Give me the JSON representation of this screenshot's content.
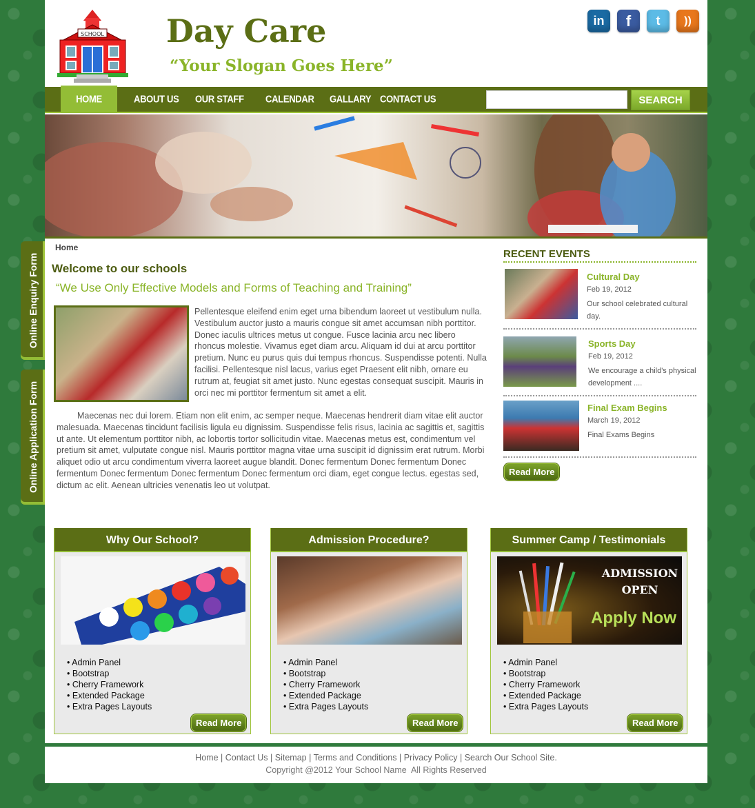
{
  "header": {
    "title": "Day Care",
    "slogan": "“Your Slogan Goes Here”",
    "logo_sign": "SCHOOL",
    "social": [
      {
        "icon": "linkedin-icon",
        "glyph": "in"
      },
      {
        "icon": "facebook-icon",
        "glyph": "f"
      },
      {
        "icon": "twitter-icon",
        "glyph": "t"
      },
      {
        "icon": "rss-icon",
        "glyph": "))"
      }
    ]
  },
  "nav": {
    "items": [
      "Home",
      "About Us",
      "Our Staff",
      "Calendar",
      "Gallary",
      "Contact Us"
    ],
    "search_placeholder": "",
    "search_label": "Search"
  },
  "side_tabs": [
    "Online Enquiry Form",
    "Online Application Form"
  ],
  "breadcrumb": "Home",
  "main": {
    "welcome": "Welcome to our schools",
    "subtitle": "“We Use Only Effective Models and Forms of Teaching and Training”",
    "intro": "Pellentesque eleifend enim eget urna bibendum laoreet ut vestibulum nulla. Vestibulum auctor justo a mauris congue sit amet accumsan nibh porttitor. Donec iaculis ultrices metus ut congue. Fusce lacinia arcu nec libero rhoncus molestie. Vivamus eget diam arcu. Aliquam id dui at arcu porttitor pretium. Nunc eu purus quis dui tempus rhoncus. Suspendisse potenti. Nulla facilisi. Pellentesque nisl lacus, varius eget Praesent elit nibh, ornare eu rutrum at, feugiat sit amet justo. Nunc egestas consequat suscipit. Mauris in orci nec mi porttitor fermentum sit amet a elit.",
    "body": "Maecenas nec dui lorem. Etiam non elit enim, ac semper neque. Maecenas hendrerit diam vitae elit auctor malesuada. Maecenas tincidunt facilisis ligula eu dignissim. Suspendisse felis risus, lacinia ac sagittis et, sagittis ut ante. Ut elementum porttitor nibh, ac lobortis tortor sollicitudin vitae. Maecenas metus est, condimentum vel pretium sit amet, vulputate congue nisl. Mauris porttitor magna vitae urna suscipit id dignissim erat rutrum. Morbi aliquet odio ut arcu condimentum viverra laoreet augue blandit. Donec fermentum Donec fermentum Donec fermentum Donec fermentum Donec fermentum Donec fermentum orci diam, eget congue lectus. egestas sed, dictum ac elit. Aenean ultricies venenatis leo ut volutpat."
  },
  "events": {
    "title": "RECENT EVENTS",
    "items": [
      {
        "title": "Cultural Day",
        "date": "Feb 19, 2012",
        "desc": "Our school celebrated cultural day."
      },
      {
        "title": "Sports Day",
        "date": "Feb 19, 2012",
        "desc": "We encourage a child's physical development ...."
      },
      {
        "title": "Final Exam Begins",
        "date": "March 19, 2012",
        "desc": "Final Exams Begins"
      }
    ],
    "read_more": "Read More"
  },
  "boxes": [
    {
      "title": "Why Our School?",
      "items": [
        "Admin Panel",
        "Bootstrap",
        "Cherry Framework",
        "Extended Package",
        "Extra Pages Layouts"
      ],
      "read_more": "Read More"
    },
    {
      "title": "Admission Procedure?",
      "items": [
        "Admin Panel",
        "Bootstrap",
        "Cherry Framework",
        "Extended Package",
        "Extra Pages Layouts"
      ],
      "read_more": "Read More"
    },
    {
      "title": "Summer Camp / Testimonials",
      "items": [
        "Admin Panel",
        "Bootstrap",
        "Cherry Framework",
        "Extended Package",
        "Extra Pages Layouts"
      ],
      "read_more": "Read More",
      "ad_line1": "ADMISSION",
      "ad_line2": "OPEN",
      "ad_cta": "Apply Now"
    }
  ],
  "footer": {
    "links": [
      "Home",
      "Contact Us",
      "Sitemap",
      "Terms and Conditions",
      "Privacy Policy",
      "Search Our School Site."
    ],
    "copyright": "Copyright @2012 Your School Name  All Rights Reserved"
  },
  "colors": {
    "brand_dark": "#5b6e15",
    "brand_light": "#8ab429",
    "background": "#2f7a3c"
  }
}
